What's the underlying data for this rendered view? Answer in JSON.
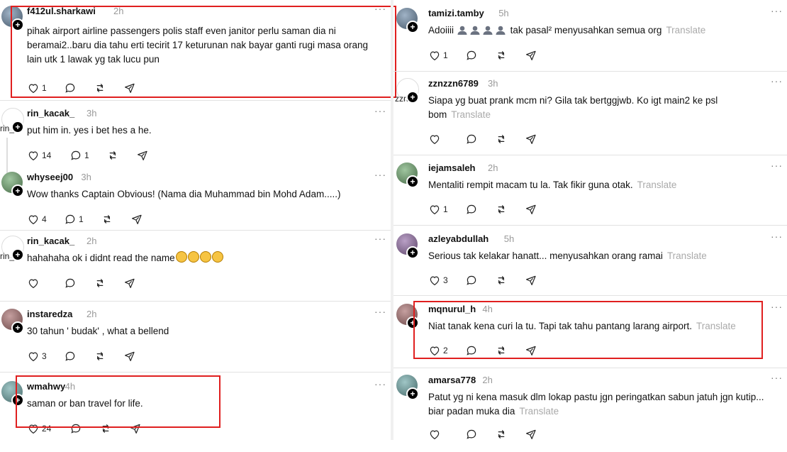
{
  "left_posts": [
    {
      "username": "f412ul.sharkawi",
      "time": "2h",
      "avatar_alt": "",
      "text": "pihak airport airline passengers polis staff even janitor perlu saman dia ni beramai2..baru dia tahu erti tecirit 17 keturunan nak bayar ganti rugi masa orang lain utk 1 lawak yg tak lucu pun",
      "likes": "1",
      "replies": ""
    },
    {
      "username": "rin_kacak_",
      "time": "3h",
      "avatar_alt": "rin_",
      "text": "put him in. yes i bet hes a he.",
      "likes": "14",
      "replies": "1"
    },
    {
      "username": "whyseej00",
      "time": "3h",
      "avatar_alt": "",
      "text": "Wow thanks Captain Obvious! (Nama dia Muhammad bin Mohd Adam.....)",
      "likes": "4",
      "replies": "1"
    },
    {
      "username": "rin_kacak_",
      "time": "2h",
      "avatar_alt": "rin_",
      "text": "hahahaha ok i didnt read the name",
      "likes": "",
      "replies": ""
    },
    {
      "username": "instaredza",
      "time": "2h",
      "avatar_alt": "",
      "text": "30 tahun ' budak' , what a bellend",
      "likes": "3",
      "replies": ""
    },
    {
      "username": "wmahwy",
      "time": "4h",
      "avatar_alt": "",
      "text": "saman or ban travel for life.",
      "likes": "24",
      "replies": ""
    }
  ],
  "right_posts": [
    {
      "username": "tamizi.tamby",
      "time": "5h",
      "avatar_alt": "",
      "text_before": "Adoiiii",
      "text": "tak pasal² menyusahkan semua org",
      "translate": "Translate",
      "likes": "1",
      "replies": ""
    },
    {
      "username": "zznzzn6789",
      "time": "3h",
      "avatar_alt": "zzn",
      "text": "Siapa yg buat prank mcm ni? Gila tak bertggjwb. Ko igt main2 ke psl bom",
      "translate": "Translate",
      "likes": "",
      "replies": ""
    },
    {
      "username": "iejamsaleh",
      "time": "2h",
      "avatar_alt": "",
      "text": "Mentaliti rempit macam tu la. Tak fikir guna otak.",
      "translate": "Translate",
      "likes": "1",
      "replies": ""
    },
    {
      "username": "azleyabdullah",
      "time": "5h",
      "avatar_alt": "",
      "text": "Serious tak kelakar hanatt... menyusahkan orang ramai",
      "translate": "Translate",
      "likes": "3",
      "replies": ""
    },
    {
      "username": "mqnurul_h",
      "time": "4h",
      "avatar_alt": "",
      "text": "Niat tanak kena curi la tu. Tapi tak tahu pantang larang airport.",
      "translate": "Translate",
      "likes": "2",
      "replies": ""
    },
    {
      "username": "amarsa778",
      "time": "2h",
      "avatar_alt": "",
      "text": "Patut yg ni kena masuk dlm lokap pastu jgn peringatkan sabun jatuh jgn kutip... biar padan muka dia",
      "translate": "Translate",
      "likes": "",
      "replies": ""
    }
  ],
  "more_label": "···",
  "plus_label": "+",
  "icons": [
    "heart-icon",
    "comment-icon",
    "repost-icon",
    "share-icon"
  ],
  "colors": {
    "highlight": "#e01f1f",
    "muted": "#999999",
    "translate": "#aaaaaa",
    "separator": "#e2e2e2"
  }
}
